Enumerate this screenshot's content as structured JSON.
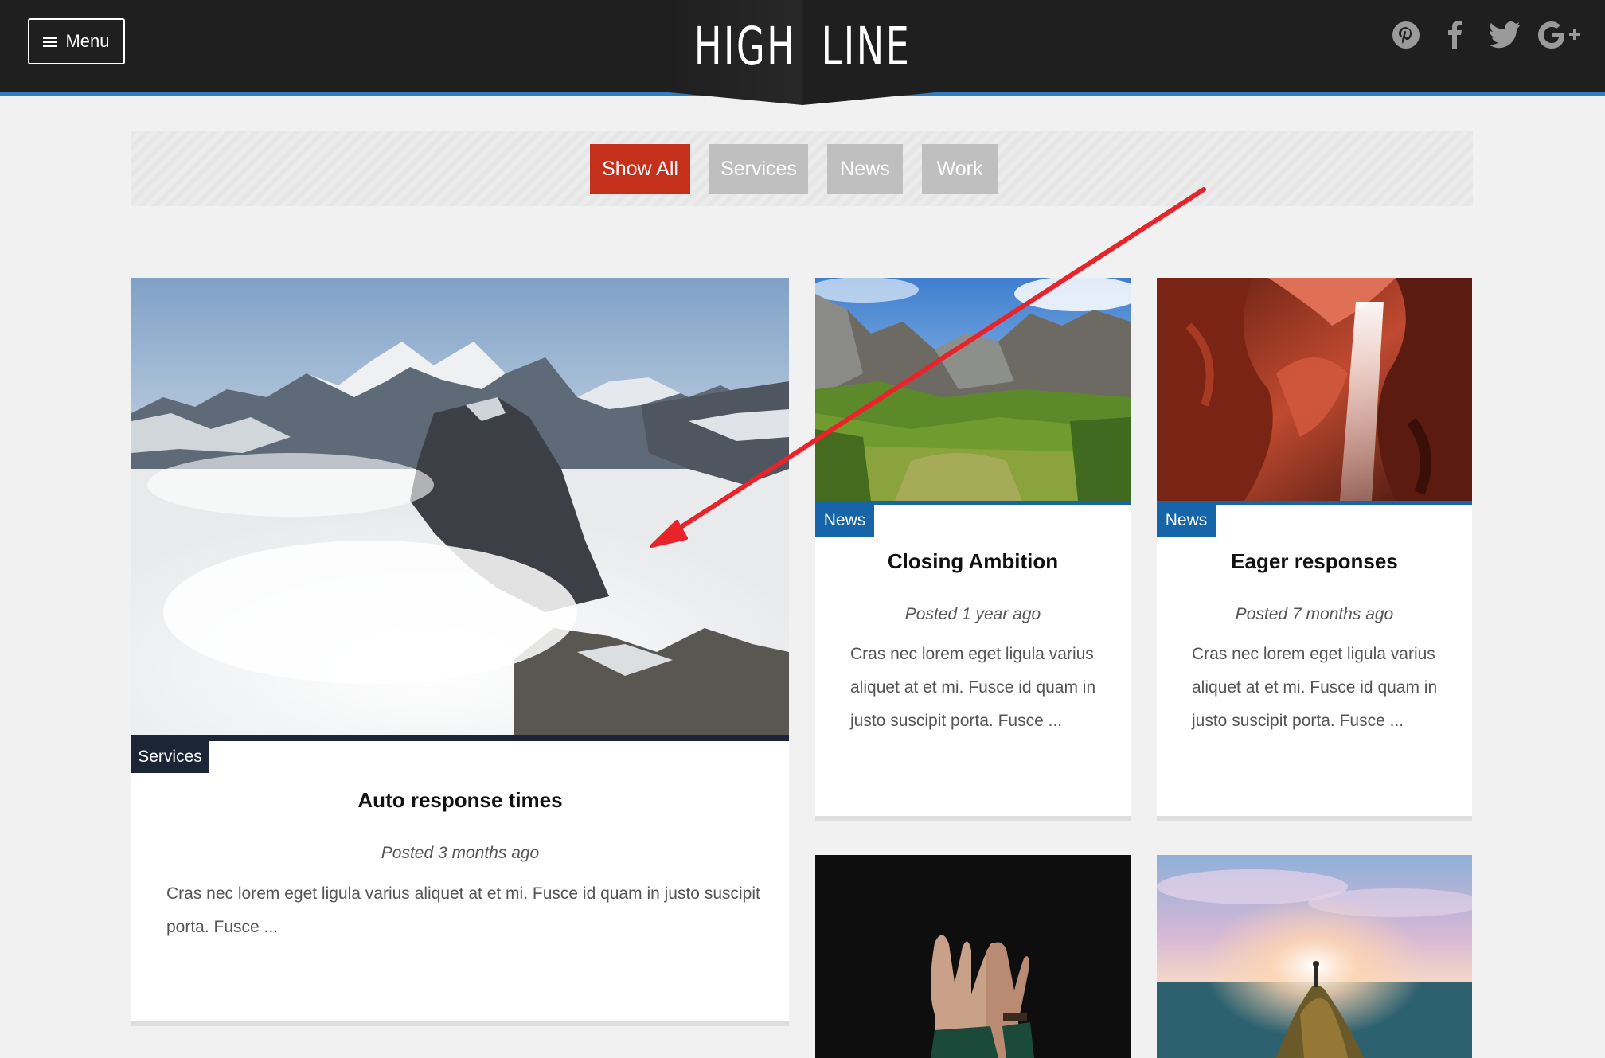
{
  "header": {
    "menu_label": "Menu",
    "logo_left": "HIGH",
    "logo_right": "LINE",
    "social_icons": [
      "pinterest-icon",
      "facebook-icon",
      "twitter-icon",
      "google-plus-icon"
    ]
  },
  "filters": [
    {
      "label": "Show All",
      "active": true
    },
    {
      "label": "Services",
      "active": false
    },
    {
      "label": "News",
      "active": false
    },
    {
      "label": "Work",
      "active": false
    }
  ],
  "colors": {
    "accent_blue": "#2f7ec2",
    "active_red": "#c4301c",
    "tag_dark": "#1b2535",
    "tag_blue": "#1565a8",
    "annotation_red": "#e8232a"
  },
  "cards": [
    {
      "tag": "Services",
      "title": "Auto response times",
      "meta": "Posted 3 months ago",
      "excerpt_lines": [
        "Cras nec lorem eget ligula varius aliquet at et mi. Fusce id quam in justo suscipit",
        "porta. Fusce ..."
      ],
      "image": "mountains-in-clouds"
    },
    {
      "tag": "News",
      "title": "Closing Ambition",
      "meta": "Posted 1 year ago",
      "excerpt_lines": [
        "Cras nec lorem eget ligula varius",
        "aliquet at et mi. Fusce id quam in",
        "justo suscipit porta. Fusce ..."
      ],
      "image": "green-valley"
    },
    {
      "tag": "News",
      "title": "Eager responses",
      "meta": "Posted 7 months ago",
      "excerpt_lines": [
        "Cras nec lorem eget ligula varius",
        "aliquet at et mi. Fusce id quam in",
        "justo suscipit porta. Fusce ..."
      ],
      "image": "red-canyon"
    },
    {
      "image": "hands-dark"
    },
    {
      "image": "sunset-sea"
    }
  ]
}
